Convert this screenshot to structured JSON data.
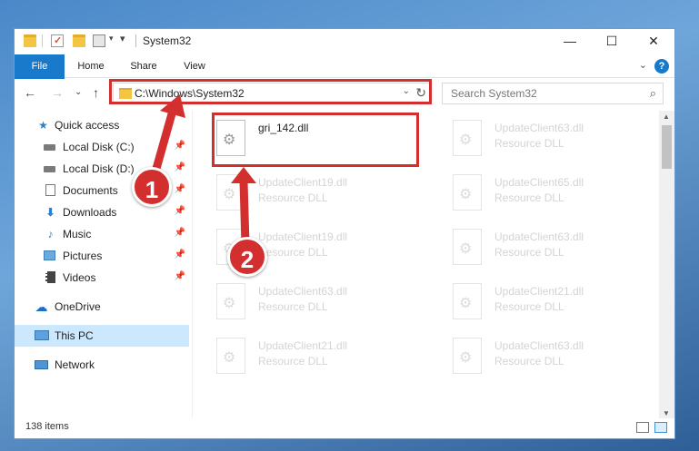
{
  "window": {
    "title": "System32",
    "controls": {
      "minimize": "—",
      "maximize": "☐",
      "close": "✕"
    }
  },
  "ribbon": {
    "tabs": [
      "File",
      "Home",
      "Share",
      "View"
    ],
    "expand": "⌄",
    "help": "?"
  },
  "nav": {
    "back": "←",
    "forward": "→",
    "recent": "⌄",
    "up": "↑",
    "address": "C:\\Windows\\System32",
    "search_placeholder": "Search System32"
  },
  "sidebar": {
    "items": [
      {
        "label": "Quick access",
        "icon": "star-icon",
        "pinned": false
      },
      {
        "label": "Local Disk (C:)",
        "icon": "drive-icon",
        "pinned": true
      },
      {
        "label": "Local Disk (D:)",
        "icon": "drive-icon",
        "pinned": true
      },
      {
        "label": "Documents",
        "icon": "documents-icon",
        "pinned": true
      },
      {
        "label": "Downloads",
        "icon": "downloads-icon",
        "pinned": true
      },
      {
        "label": "Music",
        "icon": "music-icon",
        "pinned": true
      },
      {
        "label": "Pictures",
        "icon": "pictures-icon",
        "pinned": true
      },
      {
        "label": "Videos",
        "icon": "videos-icon",
        "pinned": true
      },
      {
        "label": "OneDrive",
        "icon": "cloud-icon",
        "pinned": false
      },
      {
        "label": "This PC",
        "icon": "computer-icon",
        "pinned": false,
        "selected": true
      },
      {
        "label": "Network",
        "icon": "network-icon",
        "pinned": false
      }
    ]
  },
  "files": [
    {
      "name": "gri_142.dll",
      "type": "",
      "faded": false
    },
    {
      "name": "UpdateClient63.dll",
      "type": "Resource DLL",
      "faded": true
    },
    {
      "name": "UpdateClient19.dll",
      "type": "Resource DLL",
      "faded": true
    },
    {
      "name": "UpdateClient65.dll",
      "type": "Resource DLL",
      "faded": true
    },
    {
      "name": "UpdateClient19.dll",
      "type": "Resource DLL",
      "faded": true
    },
    {
      "name": "UpdateClient63.dll",
      "type": "Resource DLL",
      "faded": true
    },
    {
      "name": "UpdateClient63.dll",
      "type": "Resource DLL",
      "faded": true
    },
    {
      "name": "UpdateClient21.dll",
      "type": "Resource DLL",
      "faded": true
    },
    {
      "name": "UpdateClient21.dll",
      "type": "Resource DLL",
      "faded": true
    },
    {
      "name": "UpdateClient63.dll",
      "type": "Resource DLL",
      "faded": true
    }
  ],
  "status": {
    "item_count": "138 items"
  },
  "annotations": {
    "step1": "1",
    "step2": "2",
    "color": "#d32f2f"
  }
}
